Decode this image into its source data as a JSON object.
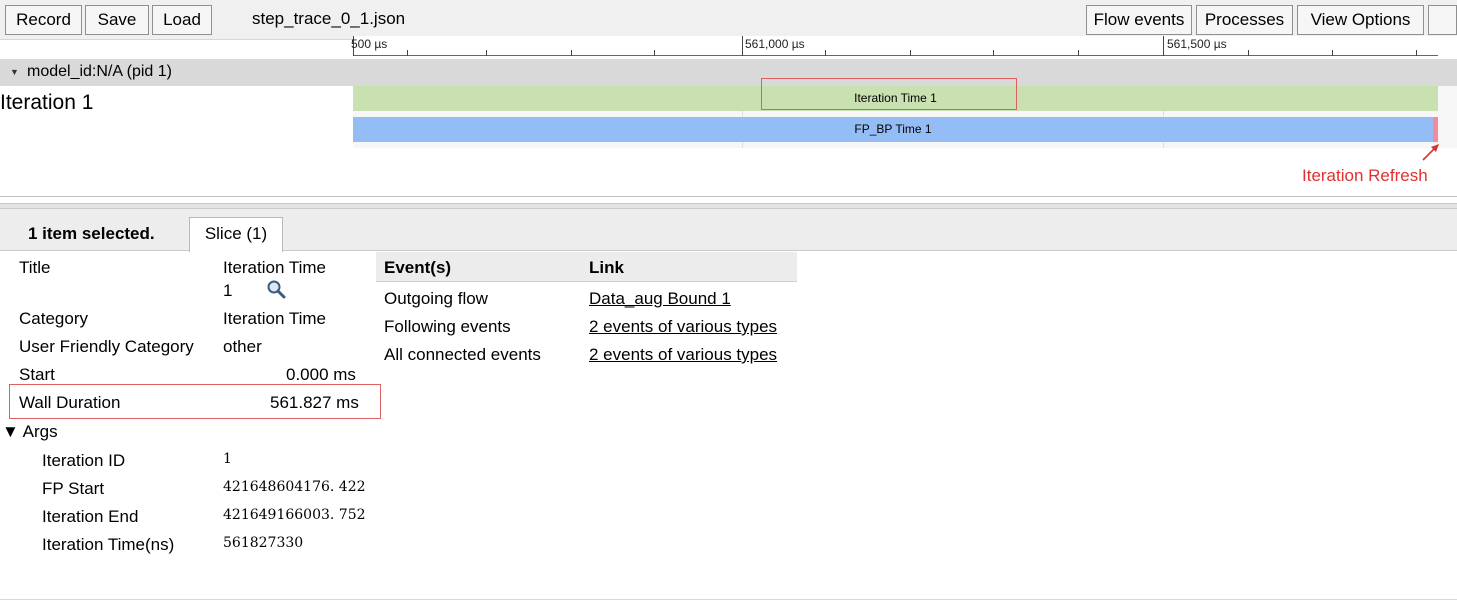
{
  "toolbar": {
    "record_label": "Record",
    "save_label": "Save",
    "load_label": "Load",
    "filename": "step_trace_0_1.json",
    "flow_events_label": "Flow events",
    "processes_label": "Processes",
    "view_options_label": "View Options"
  },
  "ruler": {
    "labels": [
      "500 µs",
      "561,000 µs",
      "561,500 µs"
    ]
  },
  "process": {
    "label": "model_id:N/A (pid 1)"
  },
  "track": {
    "label": "Iteration 1",
    "slices": {
      "iteration_time": "Iteration Time 1",
      "fp_bp_time": "FP_BP Time 1"
    },
    "annotation": "Iteration Refresh"
  },
  "analysis": {
    "selection_label": "1 item selected.",
    "tab_label": "Slice (1)",
    "details": {
      "title_key": "Title",
      "title_value_line1": "Iteration Time",
      "title_value_line2": "1",
      "category_key": "Category",
      "category_value": "Iteration Time",
      "user_category_key": "User Friendly Category",
      "user_category_value": "other",
      "start_key": "Start",
      "start_value": "0.000 ms",
      "wall_duration_key": "Wall Duration",
      "wall_duration_value": "561.827 ms",
      "args_label": "Args",
      "args": [
        {
          "key": "Iteration ID",
          "value": "1"
        },
        {
          "key": "FP Start",
          "value": "421648604176. 422"
        },
        {
          "key": "Iteration End",
          "value": "421649166003. 752"
        },
        {
          "key": "Iteration Time(ns)",
          "value": "561827330"
        }
      ]
    },
    "events": {
      "header_event": "Event(s)",
      "header_link": "Link",
      "rows": [
        {
          "event": "Outgoing flow",
          "link": "Data_aug Bound 1"
        },
        {
          "event": "Following events",
          "link": "2 events of various types"
        },
        {
          "event": "All connected events",
          "link": "2 events of various types"
        }
      ]
    }
  },
  "colors": {
    "iteration_slice": "#c9e0b1",
    "fp_bp_slice": "#94bdf5",
    "refresh_slice": "#f58a9a",
    "annotation_red": "#e03030"
  }
}
